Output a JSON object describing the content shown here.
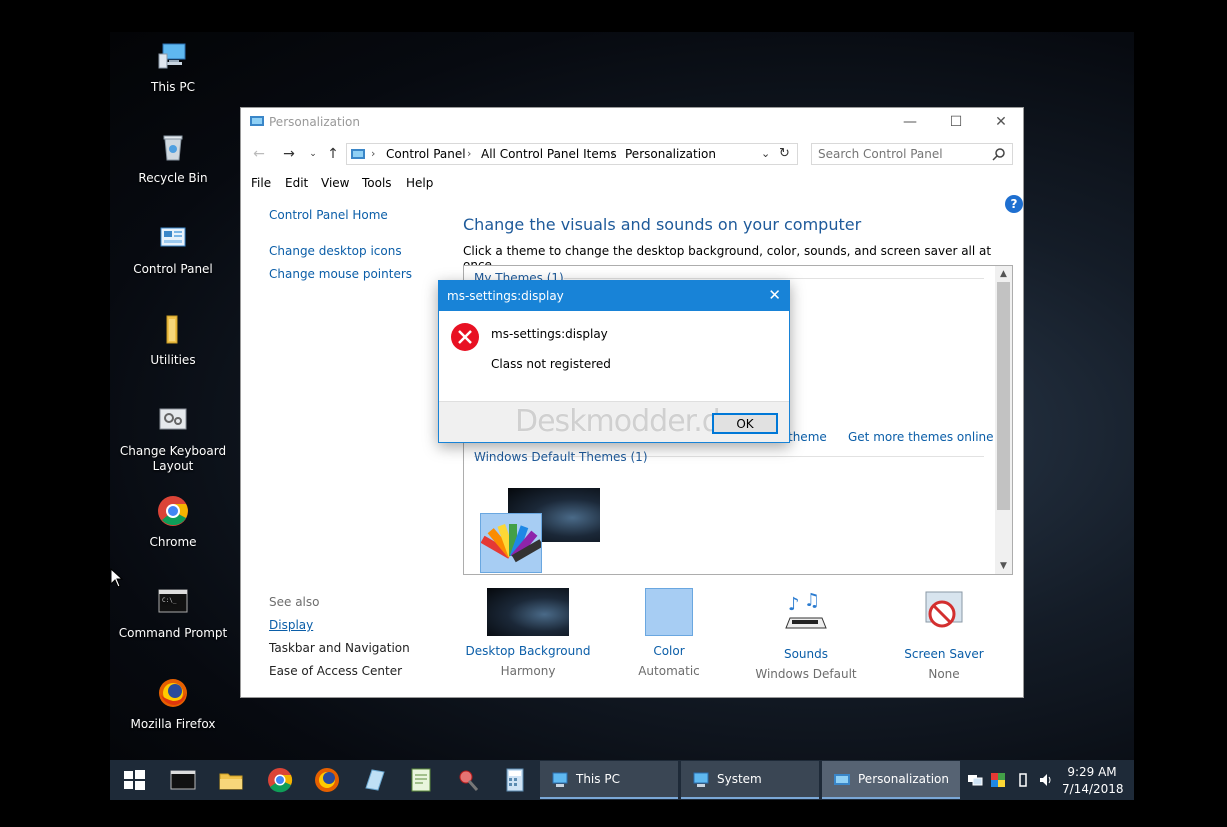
{
  "desktop": {
    "icons": [
      {
        "label": "This PC"
      },
      {
        "label": "Recycle Bin"
      },
      {
        "label": "Control Panel"
      },
      {
        "label": "Utilities"
      },
      {
        "label": "Change Keyboard Layout"
      },
      {
        "label": "Chrome"
      },
      {
        "label": "Command Prompt"
      },
      {
        "label": "Mozilla Firefox"
      }
    ]
  },
  "window": {
    "title": "Personalization",
    "controls": {
      "minimize": "—",
      "maximize": "☐",
      "close": "✕"
    },
    "address": {
      "crumbs": [
        "Control Panel",
        "All Control Panel Items",
        "Personalization"
      ]
    },
    "search": {
      "placeholder": "Search Control Panel"
    },
    "menu": [
      "File",
      "Edit",
      "View",
      "Tools",
      "Help"
    ],
    "left_pane": {
      "home": "Control Panel Home",
      "links": [
        "Change desktop icons",
        "Change mouse pointers"
      ],
      "see_also_title": "See also",
      "see_also": [
        "Display",
        "Taskbar and Navigation",
        "Ease of Access Center"
      ]
    },
    "heading": "Change the visuals and sounds on your computer",
    "subtitle": "Click a theme to change the desktop background, color, sounds, and screen saver all at once.",
    "themes": {
      "my_themes_label": "My Themes (1)",
      "save_theme_link": "theme",
      "get_more_link": "Get more themes online",
      "default_themes_label": "Windows Default Themes (1)"
    },
    "bottom_tiles": [
      {
        "label": "Desktop Background",
        "sub": "Harmony"
      },
      {
        "label": "Color",
        "sub": "Automatic"
      },
      {
        "label": "Sounds",
        "sub": "Windows Default"
      },
      {
        "label": "Screen Saver",
        "sub": "None"
      }
    ],
    "help": "?"
  },
  "dialog": {
    "title": "ms-settings:display",
    "close": "✕",
    "message1": "ms-settings:display",
    "message2": "Class not registered",
    "ok": "OK",
    "watermark": "Deskmodder.de"
  },
  "taskbar": {
    "tasks": [
      {
        "label": "This PC"
      },
      {
        "label": "System"
      },
      {
        "label": "Personalization"
      }
    ],
    "time": "9:29 AM",
    "date": "7/14/2018"
  }
}
